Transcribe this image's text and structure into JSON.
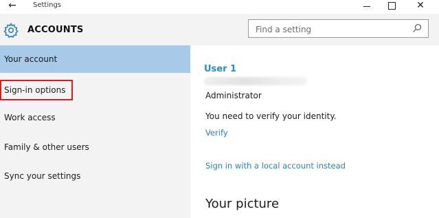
{
  "window": {
    "title": "Settings",
    "back_glyph": "←",
    "close_glyph": "✕"
  },
  "header": {
    "title": "ACCOUNTS",
    "icon": "gear-icon"
  },
  "search": {
    "placeholder": "Find a setting",
    "value": "",
    "icon": "search-icon"
  },
  "sidebar": {
    "items": [
      {
        "label": "Your account",
        "selected": true
      },
      {
        "label": "Sign-in options",
        "selected": false,
        "highlighted": true
      },
      {
        "label": "Work access",
        "selected": false
      },
      {
        "label": "Family & other users",
        "selected": false
      },
      {
        "label": "Sync your settings",
        "selected": false
      }
    ]
  },
  "main": {
    "user_name": "User 1",
    "role": "Administrator",
    "verify_message": "You need to verify your identity.",
    "verify_link": "Verify",
    "local_account_link": "Sign in with a local account instead",
    "picture_heading": "Your picture"
  },
  "colors": {
    "accent": "#2a8bd1",
    "selected_bg": "#a9c9e8",
    "highlight_border": "#d81e1e",
    "sidebar_bg": "#f3f3f3"
  }
}
